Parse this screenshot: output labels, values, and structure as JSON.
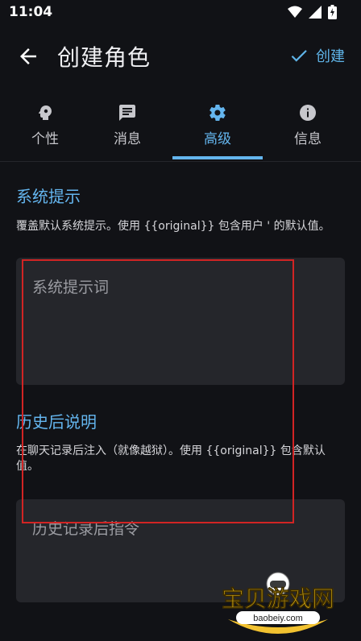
{
  "status": {
    "time": "11:04"
  },
  "appbar": {
    "title": "创建角色",
    "create_label": "创建"
  },
  "tabs": [
    {
      "label": "个性",
      "icon": "lightbulb-head-icon"
    },
    {
      "label": "消息",
      "icon": "message-icon"
    },
    {
      "label": "高级",
      "icon": "gear-icon",
      "active": true
    },
    {
      "label": "信息",
      "icon": "info-icon"
    }
  ],
  "system_prompt": {
    "title": "系统提示",
    "description": "覆盖默认系统提示。使用 {{original}} 包含用户 ' 的默认值。",
    "placeholder": "系统提示词"
  },
  "post_history": {
    "title": "历史后说明",
    "description": "在聊天记录后注入（就像越狱）。使用 {{original}} 包含默认值。",
    "placeholder": "历史记录后指令"
  },
  "watermark": {
    "text": "宝贝游戏网",
    "url": "baobeiy.com"
  },
  "colors": {
    "accent": "#64b5ee",
    "background": "#111216",
    "field": "#25262b",
    "highlight": "#d22424"
  }
}
